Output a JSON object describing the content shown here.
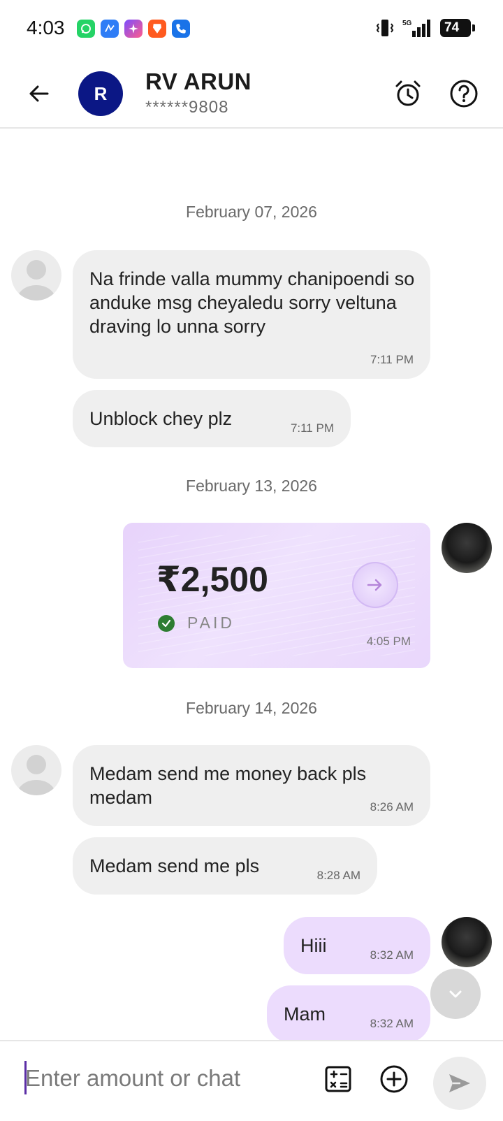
{
  "status_bar": {
    "time": "4:03",
    "apps": [
      "whatsapp-icon",
      "messenger-icon",
      "photos-icon",
      "brave-icon",
      "phone-icon"
    ],
    "network": "5G",
    "battery": "74"
  },
  "header": {
    "avatar_letter": "R",
    "name": "RV  ARUN",
    "phone": "******9808",
    "colors": {
      "avatar": "#0b1785"
    }
  },
  "chat": {
    "dates": [
      "February 07, 2026",
      "February 13, 2026",
      "February 14, 2026"
    ],
    "messages": [
      {
        "text": "Na frinde valla mummy chanipoendi so anduke msg cheyaledu sorry veltuna draving lo unna sorry",
        "time": "7:11 PM"
      },
      {
        "text": "Unblock chey plz",
        "time": "7:11 PM"
      },
      {
        "text": "Medam send me money back pls medam",
        "time": "8:26 AM"
      },
      {
        "text": "Medam send me pls",
        "time": "8:28 AM"
      },
      {
        "text": "Hiii",
        "time": "8:32 AM"
      },
      {
        "text": "Mam",
        "time": "8:32 AM"
      }
    ],
    "payment": {
      "amount": "₹2,500",
      "status": "PAID",
      "time": "4:05 PM"
    }
  },
  "input": {
    "placeholder": "Enter amount or chat"
  },
  "colors": {
    "incoming_bubble": "#efefef",
    "outgoing_bubble": "#ecdcfd",
    "paid_green": "#2e7d32"
  }
}
